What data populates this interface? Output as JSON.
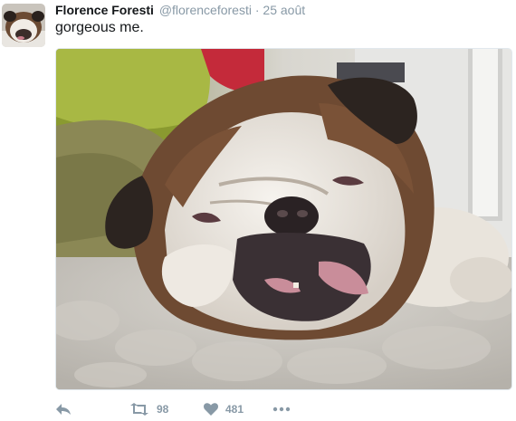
{
  "tweet": {
    "author_name": "Florence Foresti",
    "handle": "@florenceforesti",
    "separator": "·",
    "date": "25 août",
    "text": "gorgeous me."
  },
  "actions": {
    "retweet_count": "98",
    "like_count": "481"
  },
  "colors": {
    "meta_gray": "#8899a6",
    "text": "#14171a",
    "border": "#e1e8ed"
  },
  "icons": [
    "reply-icon",
    "retweet-icon",
    "heart-icon",
    "more-icon"
  ]
}
